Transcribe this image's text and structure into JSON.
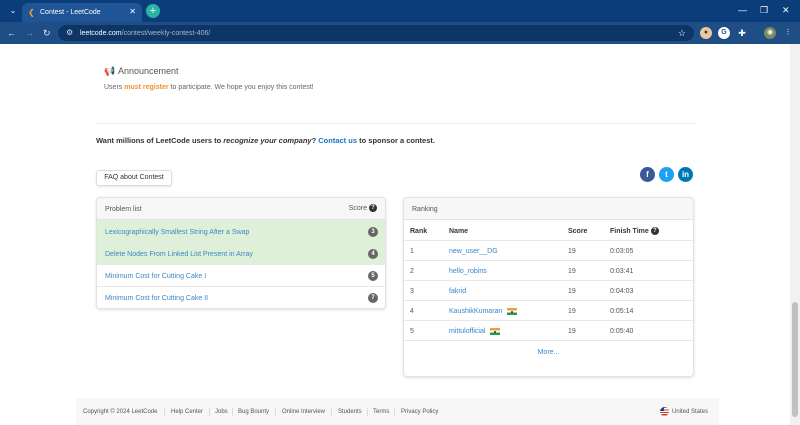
{
  "browser": {
    "tab_title": "Contest - LeetCode",
    "url_host": "leetcode.com",
    "url_path": "/contest/weekly-contest-406/"
  },
  "announcement": {
    "title": "Announcement",
    "text_before": "Users ",
    "link": "must register",
    "text_after": " to participate. We hope you enjoy this contest!"
  },
  "sponsor": {
    "part1": "Want millions of LeetCode users to ",
    "emphasis": "recognize your company",
    "part2": "? ",
    "link": "Contact us",
    "part3": " to sponsor a contest."
  },
  "faq_button": "FAQ about Contest",
  "problems": {
    "title": "Problem list",
    "score_header": "Score",
    "items": [
      {
        "title": "Lexicographically Smallest String After a Swap",
        "score": "3",
        "solved": true
      },
      {
        "title": "Delete Nodes From Linked List Present in Array",
        "score": "4",
        "solved": true
      },
      {
        "title": "Minimum Cost for Cutting Cake I",
        "score": "5",
        "solved": false
      },
      {
        "title": "Minimum Cost for Cutting Cake II",
        "score": "7",
        "solved": false
      }
    ]
  },
  "ranking": {
    "title": "Ranking",
    "headers": {
      "rank": "Rank",
      "name": "Name",
      "score": "Score",
      "finish": "Finish Time"
    },
    "rows": [
      {
        "rank": "1",
        "name": "new_user__DG",
        "score": "19",
        "time": "0:03:05",
        "flag": false
      },
      {
        "rank": "2",
        "name": "hello_robins",
        "score": "19",
        "time": "0:03:41",
        "flag": false
      },
      {
        "rank": "3",
        "name": "fakrid",
        "score": "19",
        "time": "0:04:03",
        "flag": false
      },
      {
        "rank": "4",
        "name": "KaushikKumaran",
        "score": "19",
        "time": "0:05:14",
        "flag": true
      },
      {
        "rank": "5",
        "name": "mittulofficial",
        "score": "19",
        "time": "0:05:40",
        "flag": true
      }
    ],
    "more": "More..."
  },
  "footer": {
    "copyright": "Copyright © 2024 LeetCode",
    "links": [
      "Help Center",
      "Jobs",
      "Bug Bounty",
      "Online Interview",
      "Students",
      "Terms",
      "Privacy Policy"
    ],
    "region": "United States"
  },
  "colors": {
    "accent_orange": "#f0932b",
    "link_blue": "#3a86c8",
    "solved_green": "#dff0d8",
    "facebook": "#3b5998",
    "twitter": "#1da1f2",
    "linkedin": "#0077b5"
  }
}
